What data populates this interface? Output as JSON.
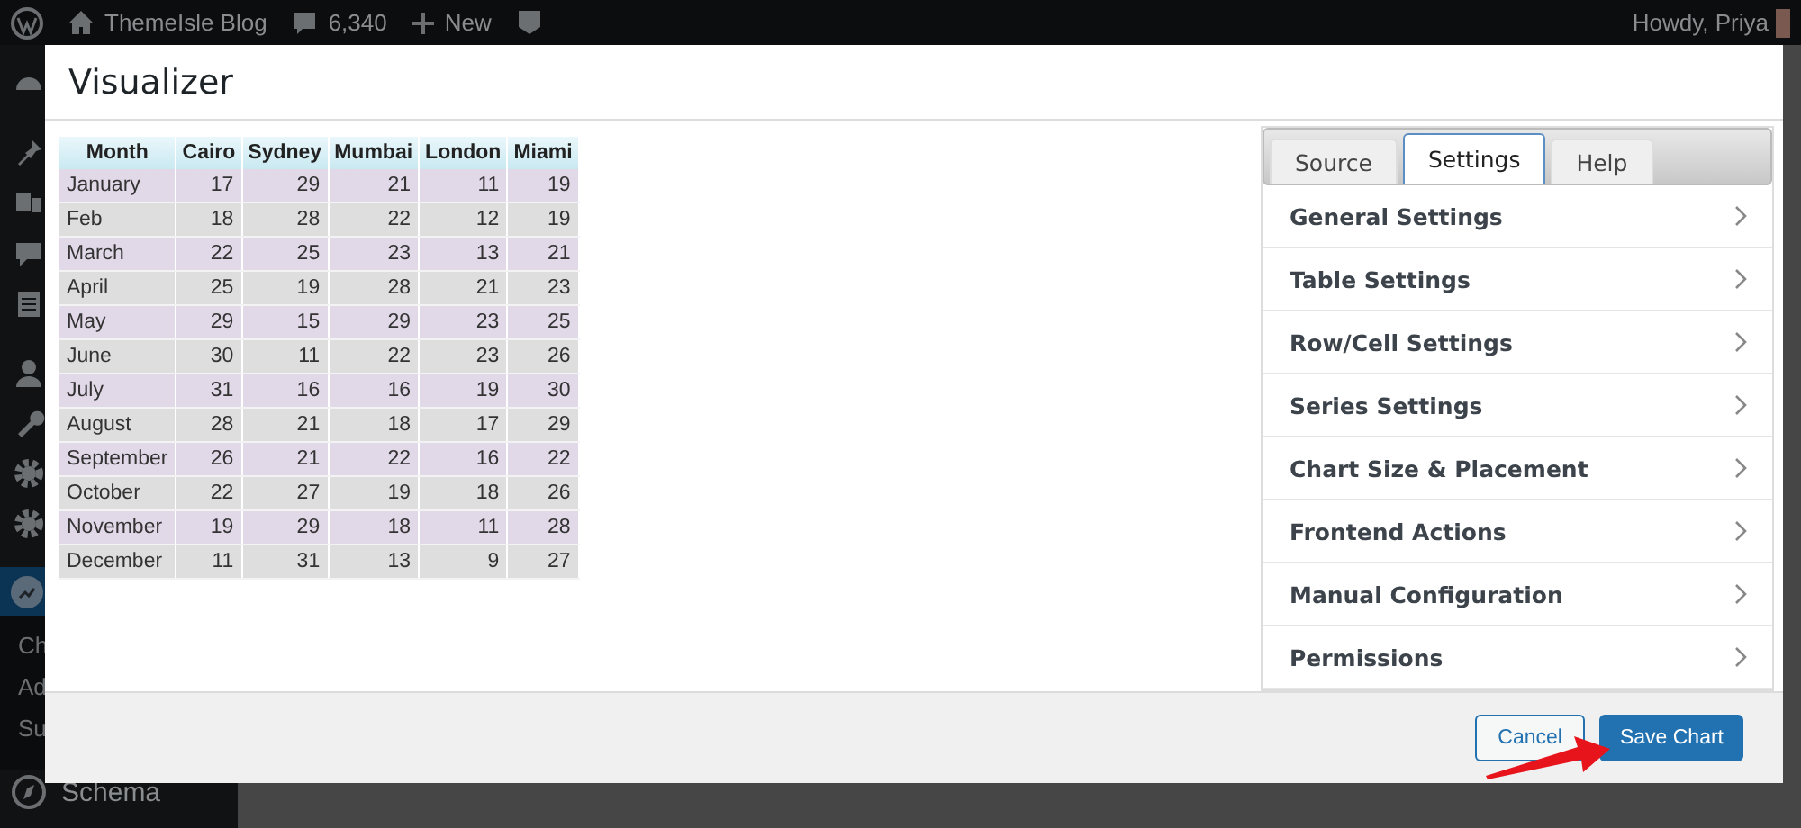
{
  "admin_bar": {
    "site": "ThemeIsle Blog",
    "comments": "6,340",
    "new": "New",
    "greeting": "Howdy, Priya"
  },
  "sidebar": {
    "submenu": [
      {
        "label": "Ch"
      },
      {
        "label": "Ad"
      },
      {
        "label": "Su"
      }
    ],
    "bottom_item": "Schema"
  },
  "modal": {
    "title": "Visualizer",
    "table": {
      "columns": [
        "Month",
        "Cairo",
        "Sydney",
        "Mumbai",
        "London",
        "Miami"
      ],
      "rows": [
        [
          "January",
          "17",
          "29",
          "21",
          "11",
          "19"
        ],
        [
          "Feb",
          "18",
          "28",
          "22",
          "12",
          "19"
        ],
        [
          "March",
          "22",
          "25",
          "23",
          "13",
          "21"
        ],
        [
          "April",
          "25",
          "19",
          "28",
          "21",
          "23"
        ],
        [
          "May",
          "29",
          "15",
          "29",
          "23",
          "25"
        ],
        [
          "June",
          "30",
          "11",
          "22",
          "23",
          "26"
        ],
        [
          "July",
          "31",
          "16",
          "16",
          "19",
          "30"
        ],
        [
          "August",
          "28",
          "21",
          "18",
          "17",
          "29"
        ],
        [
          "September",
          "26",
          "21",
          "22",
          "16",
          "22"
        ],
        [
          "October",
          "22",
          "27",
          "19",
          "18",
          "26"
        ],
        [
          "November",
          "19",
          "29",
          "18",
          "11",
          "28"
        ],
        [
          "December",
          "11",
          "31",
          "13",
          "9",
          "27"
        ]
      ]
    },
    "tabs": [
      {
        "label": "Source",
        "selected": false
      },
      {
        "label": "Settings",
        "selected": true
      },
      {
        "label": "Help",
        "selected": false
      }
    ],
    "settings": [
      "General Settings",
      "Table Settings",
      "Row/Cell Settings",
      "Series Settings",
      "Chart Size & Placement",
      "Frontend Actions",
      "Manual Configuration",
      "Permissions"
    ],
    "buttons": {
      "cancel": "Cancel",
      "save": "Save Chart"
    }
  }
}
